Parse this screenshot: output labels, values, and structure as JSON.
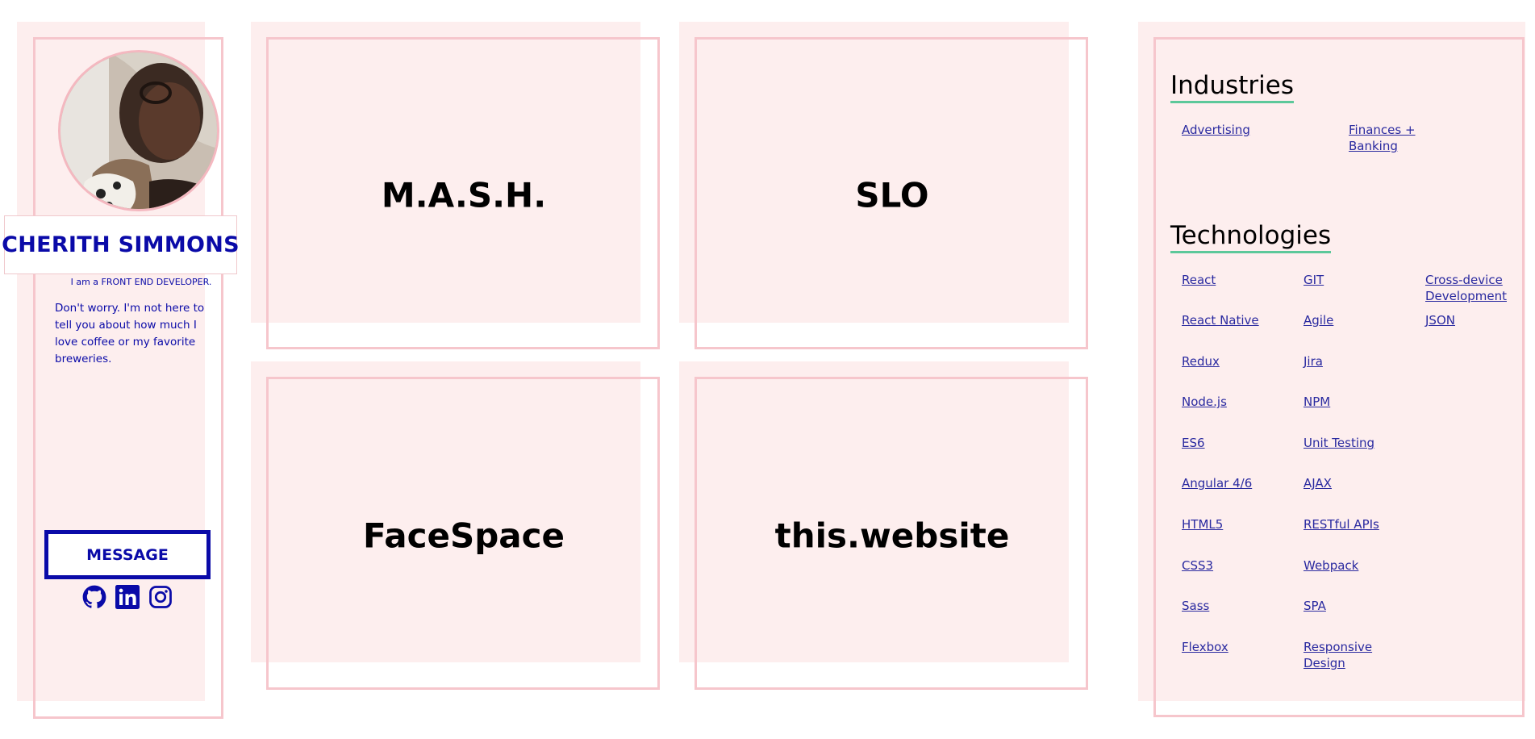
{
  "profile": {
    "name": "CHERITH SIMMONS",
    "tagline": "I am a FRONT END DEVELOPER.",
    "bio": "Don't worry. I'm not here to tell you about how much I love coffee or my favorite breweries.",
    "message_label": "MESSAGE",
    "social_icons": [
      "github-icon",
      "linkedin-icon",
      "instagram-icon"
    ]
  },
  "projects": [
    "M.A.S.H.",
    "SLO",
    "FaceSpace",
    "this.website"
  ],
  "industries": {
    "heading": "Industries",
    "items": [
      "Advertising",
      "Finances + Banking"
    ]
  },
  "technologies": {
    "heading": "Technologies",
    "columns": [
      [
        "React",
        "React Native",
        "Redux",
        "Node.js",
        "ES6",
        "Angular 4/6",
        "HTML5",
        "CSS3",
        "Sass",
        "Flexbox"
      ],
      [
        "GIT",
        "Agile",
        "Jira",
        "NPM",
        "Unit Testing",
        "AJAX",
        "RESTful APIs",
        "Webpack",
        "SPA",
        "Responsive Design"
      ],
      [
        "Cross-device Development",
        "JSON"
      ]
    ]
  },
  "colors": {
    "accent_blue": "#0a0aa8",
    "panel_pink": "#fdeeee",
    "outline_pink": "#f6c6cc",
    "heading_underline": "#5cc89a"
  }
}
